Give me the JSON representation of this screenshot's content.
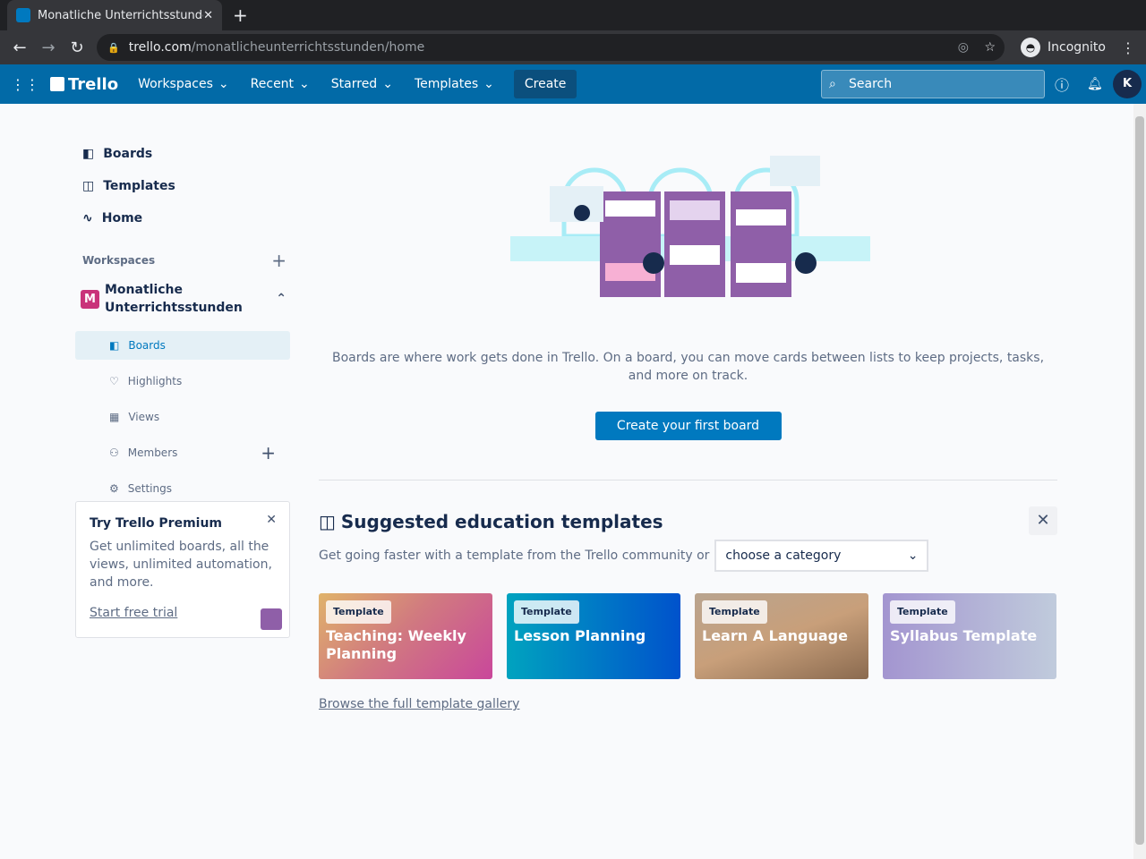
{
  "browser": {
    "tab_title": "Monatliche Unterrichtsstunden | Trello",
    "url_host": "trello.com",
    "url_path": "/monatlicheunterrichtsstunden/home",
    "profile": "Incognito"
  },
  "topnav": {
    "logo": "Trello",
    "items": [
      "Workspaces",
      "Recent",
      "Starred",
      "Templates"
    ],
    "create": "Create",
    "search_placeholder": "Search",
    "avatar": "K"
  },
  "sidebar": {
    "nav": [
      "Boards",
      "Templates",
      "Home"
    ],
    "workspaces_label": "Workspaces",
    "workspace": {
      "initial": "M",
      "name": "Monatliche Unterrichtsstunden"
    },
    "sub": [
      "Boards",
      "Highlights",
      "Views",
      "Members",
      "Settings"
    ]
  },
  "promo": {
    "title": "Try Trello Premium",
    "body": "Get unlimited boards, all the views, unlimited automation, and more.",
    "link": "Start free trial"
  },
  "main": {
    "description": "Boards are where work gets done in Trello. On a board, you can move cards between lists to keep projects, tasks, and more on track.",
    "create_button": "Create your first board",
    "suggested_title": "Suggested education templates",
    "suggested_sub": "Get going faster with a template from the Trello community or",
    "category": "choose a category",
    "templates": [
      {
        "badge": "Template",
        "title": "Teaching: Weekly Planning"
      },
      {
        "badge": "Template",
        "title": "Lesson Planning"
      },
      {
        "badge": "Template",
        "title": "Learn A Language"
      },
      {
        "badge": "Template",
        "title": "Syllabus Template"
      }
    ],
    "browse": "Browse the full template gallery"
  },
  "colors": {
    "brand": "#026aa7",
    "accent": "#0079bf"
  }
}
